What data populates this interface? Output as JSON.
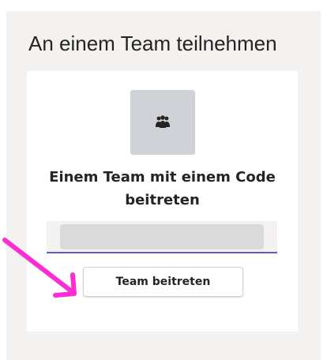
{
  "page": {
    "heading": "An einem Team teilnehmen"
  },
  "card": {
    "icon": "team-people-icon",
    "title": "Einem Team mit einem Code beitreten",
    "code_input": {
      "value": "",
      "placeholder": ""
    },
    "join_button_label": "Team beitreten"
  },
  "annotation": {
    "arrow_color": "#ff2bd5"
  },
  "colors": {
    "accent": "#5b5fc7",
    "panel_bg": "#f3f2f1",
    "icon_tile_bg": "#cfd2d6"
  }
}
